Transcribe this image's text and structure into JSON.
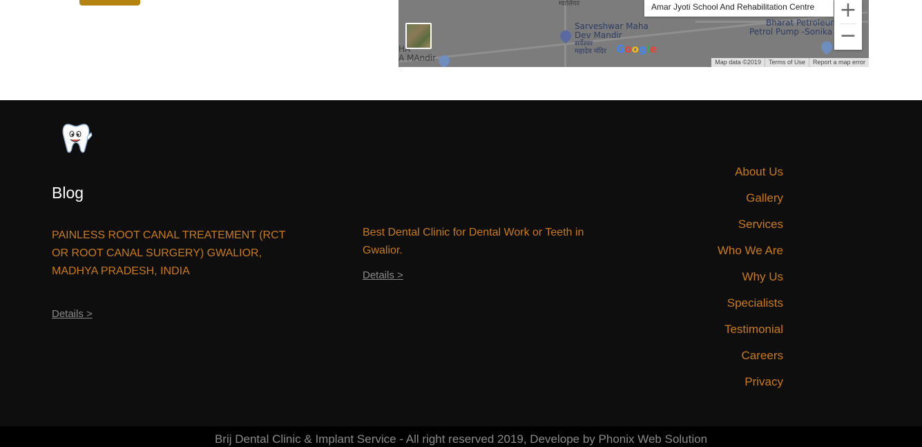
{
  "map": {
    "place_name": "Amar Jyoti School And Rehabilitation Centre",
    "labels": {
      "top_hindi": "ग्वालियर",
      "temple_en_line1": "Sarveshwar Maha",
      "temple_en_line2": "Dev Mandir",
      "temple_hi_line1": "सर्वेश्वर",
      "temple_hi_line2": "महादेव मंदिर",
      "petrol_line1": "Bharat Petroleum",
      "petrol_line2": "Petrol Pump -Sonika",
      "left_line1": "HA",
      "left_line2": "A MAndir"
    },
    "zoom_in": "+",
    "zoom_out": "−",
    "google_logo": "Google",
    "attribution": {
      "map_data": "Map data ©2019",
      "terms": "Terms of Use",
      "report": "Report a map error"
    }
  },
  "footer": {
    "blog_heading": "Blog",
    "posts": [
      {
        "title": "PAINLESS ROOT CANAL TREATEMENT (RCT OR ROOT CANAL SURGERY) GWALIOR, MADHYA PRADESH, INDIA",
        "details": "Details >"
      },
      {
        "title": "Best Dental Clinic for Dental Work or Teeth in Gwalior.",
        "details": "Details >"
      }
    ],
    "nav": [
      "About Us",
      "Gallery",
      "Services",
      "Who We Are",
      "Why Us",
      "Specialists",
      "Testimonial",
      "Careers",
      "Privacy"
    ]
  },
  "copyright": "Brij Dental Clinic & Implant Service - All right reserved 2019, Develope by Phonix Web Solution",
  "colors": {
    "accent": "#c97a1c",
    "footer_bg": "#0e0e0e",
    "button": "#b5830f"
  }
}
